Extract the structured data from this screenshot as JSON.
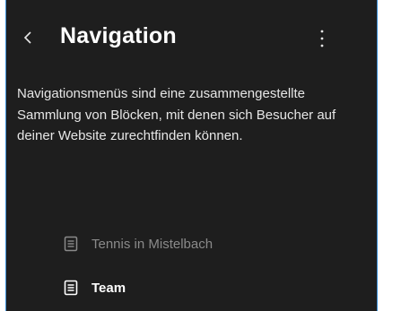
{
  "panel": {
    "title": "Navigation",
    "back_icon": "chevron-left-icon",
    "more_icon": "vertical-ellipsis-icon",
    "description": "Navigationsmenüs sind eine zusammengestellte Sammlung von Blöcken, mit denen sich Besucher auf deiner Website zurechtfinden können."
  },
  "menus": [
    {
      "label": "Tennis in Mistelbach",
      "icon": "page-icon",
      "state": "muted"
    },
    {
      "label": "Team",
      "icon": "page-icon",
      "state": "active"
    }
  ],
  "colors": {
    "background": "#1e1e1e",
    "border_accent": "#3c8fd6",
    "text": "#e6e6e6",
    "muted_text": "#8a8a8a"
  }
}
